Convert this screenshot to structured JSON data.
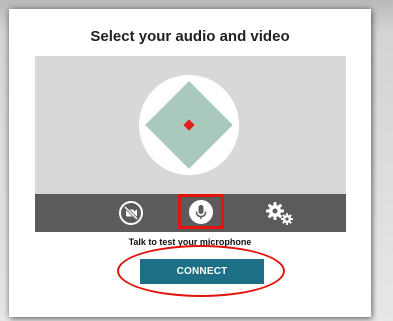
{
  "dialog": {
    "title": "Select your audio and video",
    "hint": "Talk to test your microphone",
    "connect_label": "CONNECT"
  },
  "preview": {
    "avatar_icon": "avatar-diamond-icon",
    "colors": {
      "background": "#d8d8d8",
      "circle": "#ffffff",
      "diamond": "#a8c9bc",
      "dot": "#e0201c"
    }
  },
  "controls": {
    "items": [
      {
        "icon": "camera-off-icon",
        "highlighted": false
      },
      {
        "icon": "microphone-icon",
        "highlighted": true
      },
      {
        "icon": "gear-icon",
        "highlighted": false
      }
    ],
    "bar_color": "#5b5b5b"
  },
  "colors": {
    "accent": "#1d6f86",
    "annotation": "#e3120b"
  }
}
